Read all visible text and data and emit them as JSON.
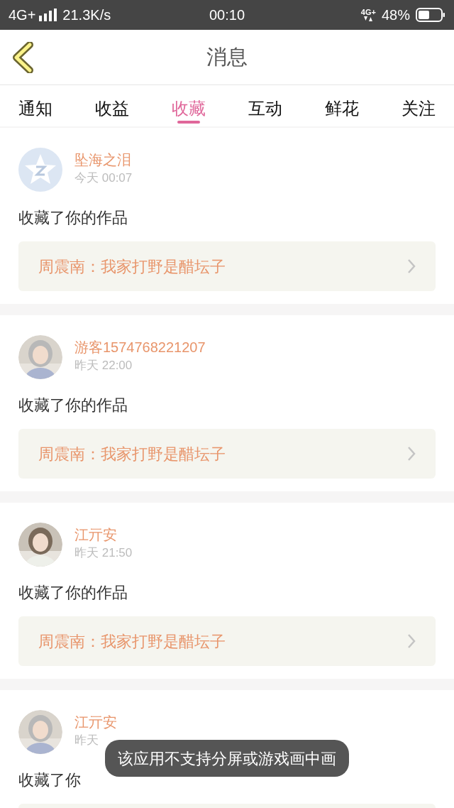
{
  "status_bar": {
    "network": "4G+",
    "speed": "21.3K/s",
    "time": "00:10",
    "network_right": "4G+",
    "battery": "48%"
  },
  "header": {
    "title": "消息"
  },
  "tabs": [
    {
      "label": "通知",
      "selected": false
    },
    {
      "label": "收益",
      "selected": false
    },
    {
      "label": "收藏",
      "selected": true
    },
    {
      "label": "互动",
      "selected": false
    },
    {
      "label": "鲜花",
      "selected": false
    },
    {
      "label": "关注",
      "selected": false
    }
  ],
  "messages": [
    {
      "kind": "default",
      "name": "坠海之泪",
      "time": "今天 00:07",
      "text": "收藏了你的作品",
      "link": "周震南：我家打野是醋坛子"
    },
    {
      "name": "游客1574768221207",
      "time": "昨天 22:00",
      "text": "收藏了你的作品",
      "link": "周震南：我家打野是醋坛子"
    },
    {
      "name": "江亓安",
      "time": "昨天 21:50",
      "text": "收藏了你的作品",
      "link": "周震南：我家打野是醋坛子"
    },
    {
      "name": "江亓安",
      "time": "昨天",
      "text": "收藏了你"
    }
  ],
  "toast": {
    "text": "该应用不支持分屏或游戏画中画"
  }
}
